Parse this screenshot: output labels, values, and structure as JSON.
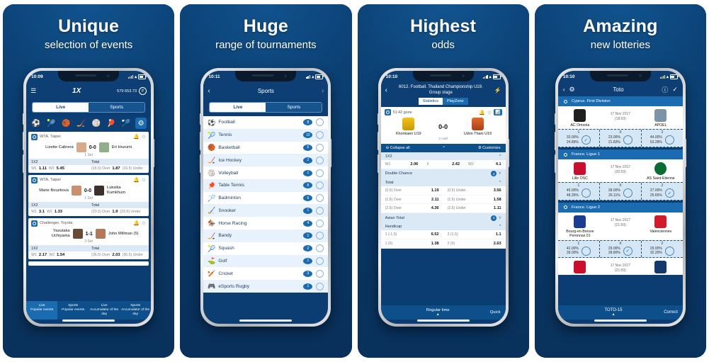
{
  "panels": [
    {
      "headline": "Unique",
      "subhead": "selection of events",
      "status": {
        "time": "10:09"
      },
      "app": {
        "brand": "1X",
        "balance": "579 653.73",
        "currency_icon": "P",
        "menu_icon": "menu-icon",
        "segment": {
          "live": "Live",
          "sports": "Sports",
          "active": "Live"
        },
        "sport_icons": [
          "football-icon",
          "tennis-icon",
          "basketball-icon",
          "ice-hockey-icon",
          "volleyball-icon",
          "table-tennis-icon",
          "badminton-icon",
          "settings-icon"
        ],
        "events": [
          {
            "league": "WTA. Taipei",
            "home": "Lizette Cabrera",
            "away": "Eri Hozumi",
            "score": "0-0",
            "period": "1 Set",
            "market_left": "1X2",
            "market_right": "Total",
            "odds": [
              {
                "label": "W1",
                "value": "1.11"
              },
              {
                "label": "W2",
                "value": "5.45"
              },
              {
                "label": "(16.5) Over",
                "value": "1.87"
              },
              {
                "label": "(16.5) Under",
                "value": ""
              }
            ]
          },
          {
            "league": "WTA. Taipei",
            "home": "Marie Bouzkova",
            "away": "Luksika Kumkhum",
            "score": "0-0",
            "period": "1 Set",
            "market_left": "1X2",
            "market_right": "Total",
            "odds": [
              {
                "label": "W1",
                "value": "3.1"
              },
              {
                "label": "W2",
                "value": "1.33"
              },
              {
                "label": "(23.5) Over",
                "value": "1.9"
              },
              {
                "label": "(23.5) Under",
                "value": ""
              }
            ]
          },
          {
            "league": "Challenger. Toyota",
            "home": "Yasutaka Uchiyama",
            "away": "John Millman (5)",
            "score": "1-1",
            "period": "3 Set",
            "market_left": "1X2",
            "market_right": "Total",
            "odds": [
              {
                "label": "W1",
                "value": "2.17"
              },
              {
                "label": "W2",
                "value": "1.54"
              },
              {
                "label": "(36.5) Over",
                "value": "2.03"
              },
              {
                "label": "(36.5) Under",
                "value": ""
              }
            ]
          }
        ],
        "bottom_tabs": [
          {
            "line1": "Live",
            "line2": "Popular events",
            "active": true
          },
          {
            "line1": "Sports",
            "line2": "Popular events",
            "active": false
          },
          {
            "line1": "Live",
            "line2": "Accumulator of the day",
            "active": false
          },
          {
            "line1": "Sports",
            "line2": "Accumulator of the day",
            "active": false
          }
        ]
      }
    },
    {
      "headline": "Huge",
      "subhead": "range of tournaments",
      "status": {
        "time": "10:11"
      },
      "app": {
        "title": "Sports",
        "back_icon": "chevron-left-icon",
        "forward_icon": "chevron-right-icon",
        "segment": {
          "live": "Live",
          "sports": "Sports",
          "active": "Live"
        },
        "sports": [
          {
            "name": "Football",
            "icon": "football-icon",
            "count": "8"
          },
          {
            "name": "Tennis",
            "icon": "tennis-icon",
            "count": "10"
          },
          {
            "name": "Basketball",
            "icon": "basketball-icon",
            "count": "6"
          },
          {
            "name": "Ice Hockey",
            "icon": "ice-hockey-icon",
            "count": "2"
          },
          {
            "name": "Volleyball",
            "icon": "volleyball-icon",
            "count": "1"
          },
          {
            "name": "Table Tennis",
            "icon": "table-tennis-icon",
            "count": "8"
          },
          {
            "name": "Badminton",
            "icon": "badminton-icon",
            "count": "6"
          },
          {
            "name": "Snooker",
            "icon": "snooker-icon",
            "count": "1"
          },
          {
            "name": "Horse Racing",
            "icon": "horse-racing-icon",
            "count": "4"
          },
          {
            "name": "Bandy",
            "icon": "bandy-icon",
            "count": "1"
          },
          {
            "name": "Squash",
            "icon": "squash-icon",
            "count": "2"
          },
          {
            "name": "Golf",
            "icon": "golf-icon",
            "count": "1"
          },
          {
            "name": "Cricket",
            "icon": "cricket-icon",
            "count": "3"
          },
          {
            "name": "eSports Rugby",
            "icon": "esports-icon",
            "count": "1"
          }
        ]
      }
    },
    {
      "headline": "Highest",
      "subhead": "odds",
      "status": {
        "time": "10:10"
      },
      "app": {
        "title": "6012. Football. Thailand Championship U19. Group stage",
        "back_icon": "chevron-left-icon",
        "flash_icon": "lightning-icon",
        "tabs": [
          {
            "label": "Statistics",
            "active": true
          },
          {
            "label": "PlayZone",
            "active": false
          }
        ],
        "timer": "51:42 gone",
        "home_team": "Khonkaen U19",
        "away_team": "Udon Thani U19",
        "score": "0-0",
        "period": "2 Half",
        "tools": [
          {
            "label": "Collapse all",
            "icon": "collapse-icon"
          },
          {
            "label": "",
            "icon": "chevron-up-icon"
          },
          {
            "label": "Customize",
            "icon": "gear-icon"
          }
        ],
        "markets": [
          {
            "name": "1X2",
            "open": true,
            "badge": "",
            "rows": [
              [
                {
                  "l": "W1",
                  "v": "2.06"
                },
                {
                  "l": "X",
                  "v": "2.42"
                },
                {
                  "l": "W2",
                  "v": "4.1"
                }
              ]
            ]
          },
          {
            "name": "Double Chance",
            "open": false,
            "badge": "3",
            "rows": []
          },
          {
            "name": "Total",
            "open": true,
            "badge": "",
            "rows": [
              [
                {
                  "l": "(0.5) Over",
                  "v": "1.19"
                },
                {
                  "l": "(0.5) Under",
                  "v": "3.56"
                }
              ],
              [
                {
                  "l": "(1.5) Over",
                  "v": "2.11"
                },
                {
                  "l": "(1.5) Under",
                  "v": "1.58"
                }
              ],
              [
                {
                  "l": "(2.5) Over",
                  "v": "4.36"
                },
                {
                  "l": "(2.5) Under",
                  "v": "1.11"
                }
              ]
            ]
          },
          {
            "name": "Asian Total",
            "open": false,
            "badge": "3",
            "rows": []
          },
          {
            "name": "Handicap",
            "open": true,
            "badge": "",
            "rows": [
              [
                {
                  "l": "1 (-1.5)",
                  "v": "6.52"
                },
                {
                  "l": "2 (1.5)",
                  "v": "1.1"
                }
              ],
              [
                {
                  "l": "1 (0)",
                  "v": "1.38"
                },
                {
                  "l": "2 (0)",
                  "v": "2.63"
                }
              ]
            ]
          }
        ],
        "footer": {
          "left": "Regular time",
          "right": "Quick",
          "caret": "caret-up-icon"
        }
      }
    },
    {
      "headline": "Amazing",
      "subhead": "new lotteries",
      "status": {
        "time": "10:10"
      },
      "app": {
        "title": "Toto",
        "back_icon": "chevron-left-icon",
        "gear_icon": "gear-icon",
        "info_icon": "info-icon",
        "check_icon": "check-icon",
        "pick_headers": [
          "1",
          "X",
          "2"
        ],
        "leagues": [
          {
            "league": "Cyprus. First Division",
            "date": "17 Nov 2017",
            "time": "(18:59)",
            "home": "AC Omonia",
            "away": "APOEL",
            "home_crest_color": "#1f1f1f",
            "away_crest_color": "#7c93a8",
            "picks": [
              {
                "p1": "33.00%",
                "p2": "24.89%",
                "selected": true
              },
              {
                "p1": "23.00%",
                "p2": "21.83%",
                "selected": false
              },
              {
                "p1": "44.00%",
                "p2": "53.28%",
                "selected": false
              }
            ]
          },
          {
            "league": "France. Ligue 1",
            "date": "17 Nov 2017",
            "time": "(20:59)",
            "home": "Lille OSC",
            "away": "AS Saint-Etienne",
            "home_crest_color": "#c8102e",
            "away_crest_color": "#0a6b33",
            "picks": [
              {
                "p1": "45.00%",
                "p2": "48.25%",
                "selected": false
              },
              {
                "p1": "28.00%",
                "p2": "26.11%",
                "selected": false
              },
              {
                "p1": "27.00%",
                "p2": "25.65%",
                "selected": true
              }
            ]
          },
          {
            "league": "France. Ligue 2",
            "date": "17 Nov 2017",
            "time": "(21:59)",
            "home": "Bourg-en-Bresse Peronnas 01",
            "away": "Valenciennes",
            "home_crest_color": "#1a3d8f",
            "away_crest_color": "#d11a2a",
            "picks": [
              {
                "p1": "42.00%",
                "p2": "39.00%",
                "selected": false
              },
              {
                "p1": "29.00%",
                "p2": "28.80%",
                "selected": true
              },
              {
                "p1": "29.00%",
                "p2": "32.20%",
                "selected": false
              }
            ]
          },
          {
            "league": "",
            "date": "17 Nov 2017",
            "time": "(21:59)",
            "home": "",
            "away": "",
            "home_crest_color": "#c8102e",
            "away_crest_color": "#123a6b",
            "picks": []
          }
        ],
        "footer": {
          "left": "TOTO-15",
          "right": "Correct",
          "caret": "caret-up-icon"
        }
      }
    }
  ]
}
